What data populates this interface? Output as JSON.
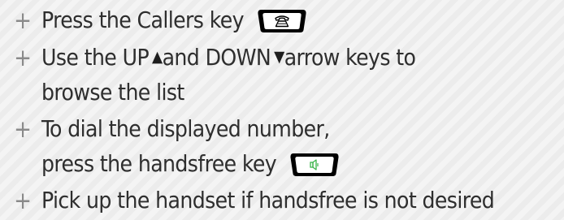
{
  "instructions": [
    {
      "line1_before": "Press the Callers key",
      "key_icon": "callers-key-icon"
    },
    {
      "line1_before": "Use the UP",
      "up_arrow": "▲",
      "line1_middle": " and DOWN",
      "down_arrow": "▼",
      "line1_after": " arrow keys to",
      "line2": "browse the list"
    },
    {
      "line1": "To dial the displayed number,",
      "line2_before": "press the handsfree key",
      "key_icon": "handsfree-key-icon",
      "handsfree_icon_color": "#3cb54a"
    },
    {
      "line1": "Pick up the handset if handsfree is not desired"
    }
  ],
  "bullet_symbol": "+",
  "colors": {
    "text": "#2e2e2e",
    "bullet": "#8a8a8a",
    "key_body": "#000000",
    "key_face": "#ffffff",
    "handsfree_icon": "#3cb54a"
  }
}
